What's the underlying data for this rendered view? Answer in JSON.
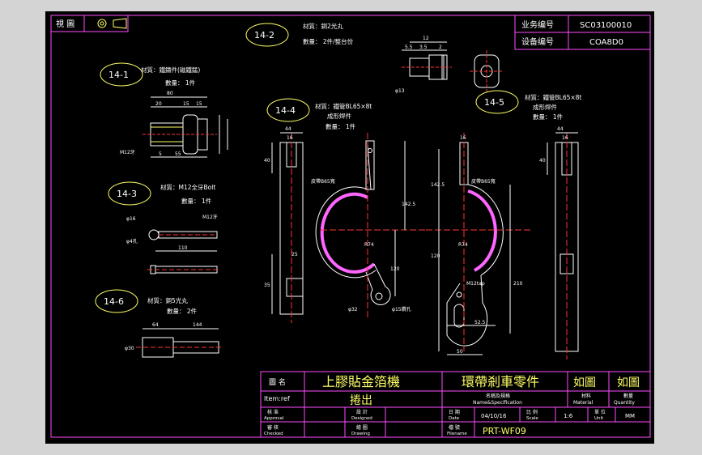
{
  "header": {
    "view_label": "視 圖",
    "business_no_label": "业务编号",
    "business_no_value": "SC03100010",
    "equipment_no_label": "设备编号",
    "equipment_no_value": "COA8D0"
  },
  "parts": [
    {
      "id": "14-1",
      "material": "材質：鐵鑄件(磁鐵錳)",
      "qty": "數量： 1件"
    },
    {
      "id": "14-2",
      "material": "材質：銅2光丸",
      "qty": "數量： 2件/整台份"
    },
    {
      "id": "14-3",
      "material": "材質：M12全牙Bolt",
      "qty": "數量： 1件"
    },
    {
      "id": "14-4",
      "material": "材質：鐵管BL65×8t",
      "process": "成形焊件",
      "qty": "數量： 1件"
    },
    {
      "id": "14-5",
      "material": "材質：鐵管BL65×8t",
      "process": "成形焊件",
      "qty": "數量： 1件"
    },
    {
      "id": "14-6",
      "material": "材質：銅5光丸",
      "qty": "數量： 2件"
    }
  ],
  "dimensions": {
    "p2_top": "12",
    "p2_a": "5.5",
    "p2_b": "3.5",
    "p2_c": "2",
    "p2_dia": "φ13",
    "p1_total": "80",
    "p1_a": "20",
    "p1_b": "15",
    "p1_c": "15",
    "p1_d": "5",
    "p1_e": "55",
    "p1_thread": "M12牙",
    "p3_dia": "φ16",
    "p3_len": "110",
    "p3_thread": "M12牙",
    "p3_hole": "φ4孔",
    "p6_a": "64",
    "p6_b": "144",
    "p6_dia": "φ30",
    "p4_w": "44",
    "p4_a": "16",
    "p4_b": "40",
    "p4_c": "35",
    "p4_d": "25",
    "p4_h1": "142.5",
    "p4_h2": "120",
    "p4_r": "R74",
    "p4_hole": "φ15鑽孔",
    "p4_hole2": "φ32",
    "p4_belt": "皮帶B65寬",
    "p5_w": "16",
    "p5_h1": "142.5",
    "p5_h2": "120",
    "p5_h3": "210",
    "p5_r": "R74",
    "p5_tap": "M12tap",
    "p5_a": "52.5",
    "p5_b": "50",
    "p5_belt": "皮帶B65寬",
    "p5s_w": "44",
    "p5s_a": "16",
    "p5s_b": "40"
  },
  "title_block": {
    "name_label": "圖 名",
    "item_label": "Item:ref",
    "title1": "上膠貼金箔機",
    "title2": "捲出",
    "part_name": "環帶剎車零件",
    "part_name_sub": "名稱及規格",
    "part_name_sub_en": "Name&Specification",
    "material_value": "如圖",
    "quantity_value": "如圖",
    "material_label": "材料",
    "material_label_en": "Material",
    "quantity_label": "數量",
    "quantity_label_en": "Quantity",
    "approval": "核 准",
    "approval_en": "Approval",
    "design": "設 計",
    "design_en": "Designed",
    "check": "審 核",
    "check_en": "Checked",
    "draw": "繪 圖",
    "draw_en": "Drawing",
    "date_label": "日 期",
    "date_label_en": "Date",
    "date_value": "04/10/16",
    "scale_label": "比 例",
    "scale_label_en": "Scale",
    "scale_value": "1:6",
    "unit_label": "單 位",
    "unit_label_en": "Unit",
    "unit_value": "MM",
    "file_label": "檔 號",
    "file_label_en": "Filename",
    "file_value": "PRT-WF09"
  }
}
